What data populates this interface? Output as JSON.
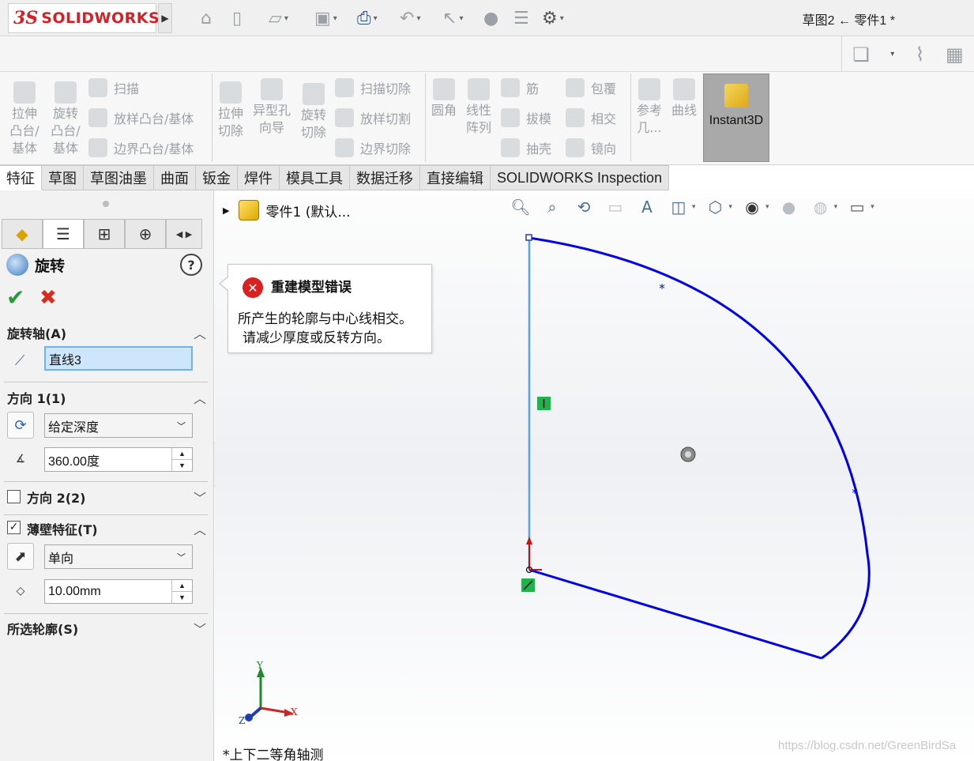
{
  "app": {
    "logo_ds": "3S",
    "logo_name": "SOLIDWORKS",
    "document_title": "草图2 ← 零件1 *"
  },
  "ribbon": {
    "extrude_boss": "拉伸\n凸台/\n基体",
    "revolve_boss": "旋转\n凸台/\n基体",
    "sweep": "扫描",
    "loft": "放样凸台/基体",
    "boundary_boss": "边界凸台/基体",
    "extrude_cut": "拉伸\n切除",
    "hole_wizard": "异型孔\n向导",
    "revolve_cut": "旋转\n切除",
    "swept_cut": "扫描切除",
    "lofted_cut": "放样切割",
    "boundary_cut": "边界切除",
    "fillet": "圆角",
    "linear_pattern": "线性\n阵列",
    "rib": "筋",
    "draft": "拔模",
    "shell": "抽壳",
    "wrap": "包覆",
    "intersect": "相交",
    "mirror": "镜向",
    "reference_geometry": "参考\n几...",
    "curves": "曲线",
    "instant3d": "Instant3D"
  },
  "tabs": [
    "特征",
    "草图",
    "草图油墨",
    "曲面",
    "钣金",
    "焊件",
    "模具工具",
    "数据迁移",
    "直接编辑",
    "SOLIDWORKS Inspection"
  ],
  "property_manager": {
    "title": "旋转",
    "axis_section": "旋转轴(A)",
    "axis_value": "直线3",
    "direction1_section": "方向 1(1)",
    "end_condition": "给定深度",
    "angle_value": "360.00度",
    "direction2_section": "方向 2(2)",
    "thin_feature_section": "薄壁特征(T)",
    "thin_type": "单向",
    "thickness_value": "10.00mm",
    "selected_contours_section": "所选轮廓(S)"
  },
  "graphics": {
    "tree_root": "零件1  (默认...",
    "error_title": "重建模型错误",
    "error_line1": "所产生的轮廓与中心线相交。",
    "error_line2": "请减少厚度或反转方向。",
    "view_orientation": "*上下二等角轴测",
    "watermark": "https://blog.csdn.net/GreenBirdSa",
    "triad_x": "X",
    "triad_y": "Y",
    "triad_z": "Z"
  },
  "colors": {
    "sketch_line": "#0000e6",
    "centerline": "#5aa0e8",
    "brand_red": "#d61f26",
    "accept_green": "#2a9a38",
    "cancel_red": "#d62d20"
  }
}
